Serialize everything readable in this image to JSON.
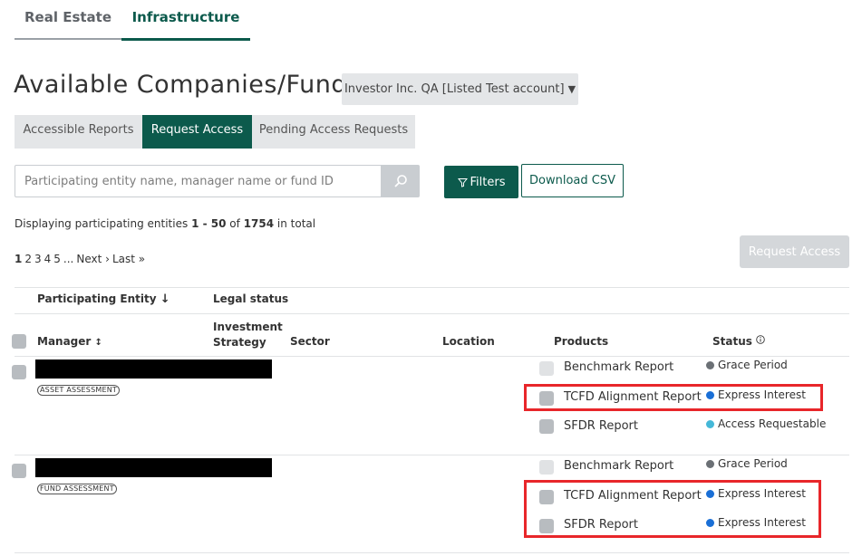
{
  "top_tabs": [
    {
      "label": "Real Estate"
    },
    {
      "label": "Infrastructure"
    }
  ],
  "title": "Available Companies/Funds",
  "account_select": {
    "value": "Investor Inc. QA [Listed Test account]"
  },
  "sub_tabs": [
    {
      "label": "Accessible Reports"
    },
    {
      "label": "Request Access"
    },
    {
      "label": "Pending Access Requests"
    }
  ],
  "search": {
    "placeholder": "Participating entity name, manager name or fund ID"
  },
  "filters_label": "Filters",
  "download_csv_label": "Download CSV",
  "display": {
    "prefix": "Displaying participating entities",
    "range": "1 - 50",
    "of": "of",
    "total": "1754",
    "suffix": "in total"
  },
  "pagination": [
    "1",
    "2",
    "3",
    "4",
    "5",
    "...",
    "Next ›",
    "Last »"
  ],
  "request_access_label": "Request Access",
  "table": {
    "headers": {
      "participating_entity": "Participating Entity",
      "legal_status": "Legal status",
      "manager": "Manager",
      "investment_strategy_1": "Investment",
      "investment_strategy_2": "Strategy",
      "sector": "Sector",
      "location": "Location",
      "products": "Products",
      "status": "Status"
    },
    "rows": [
      {
        "tag": "ASSET ASSESSMENT",
        "products": [
          {
            "name": "Benchmark Report",
            "status": "Grace Period",
            "status_color": "#6b7075"
          },
          {
            "name": "TCFD Alignment Report",
            "status": "Express Interest",
            "status_color": "#1a6fd6"
          },
          {
            "name": "SFDR Report",
            "status": "Access Requestable",
            "status_color": "#45b8d8"
          }
        ]
      },
      {
        "tag": "FUND ASSESSMENT",
        "products": [
          {
            "name": "Benchmark Report",
            "status": "Grace Period",
            "status_color": "#6b7075"
          },
          {
            "name": "TCFD Alignment Report",
            "status": "Express Interest",
            "status_color": "#1a6fd6"
          },
          {
            "name": "SFDR Report",
            "status": "Express Interest",
            "status_color": "#1a6fd6"
          }
        ]
      }
    ]
  },
  "colors": {
    "brand": "#0c5a4c",
    "highlight": "#e8262a"
  }
}
